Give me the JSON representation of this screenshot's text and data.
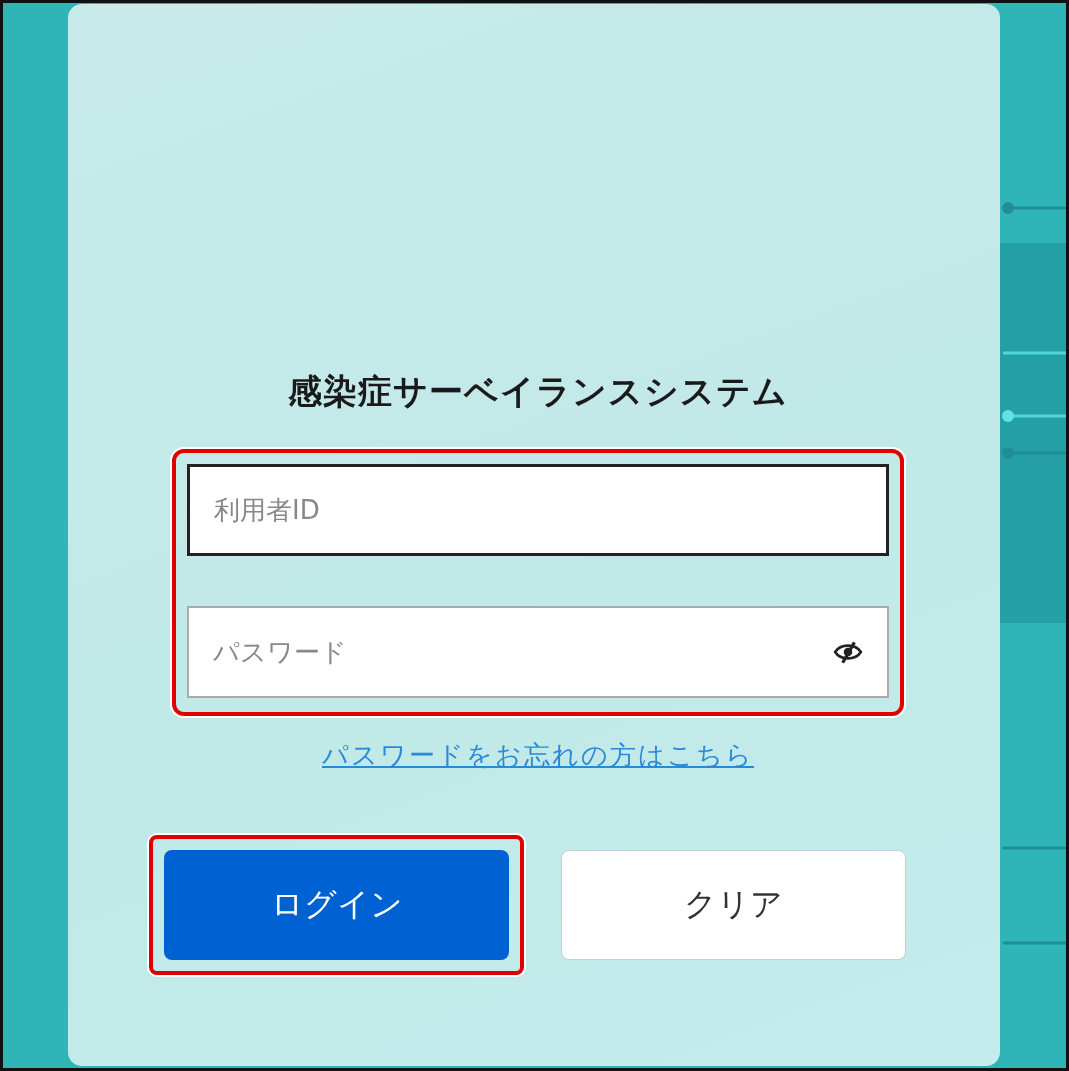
{
  "title": "感染症サーベイランスシステム",
  "login_fields": {
    "highlighted": true,
    "fields": [
      {
        "kind": "text",
        "placeholder": "利用者ID",
        "focused": true
      },
      {
        "kind": "password",
        "placeholder": "パスワード",
        "focused": false
      }
    ]
  },
  "forgot_link": "パスワードをお忘れの方はこちら",
  "buttons": [
    {
      "kind": "primary",
      "label": "ログイン",
      "highlighted": true
    },
    {
      "kind": "secondary",
      "label": "クリア",
      "highlighted": false
    }
  ]
}
